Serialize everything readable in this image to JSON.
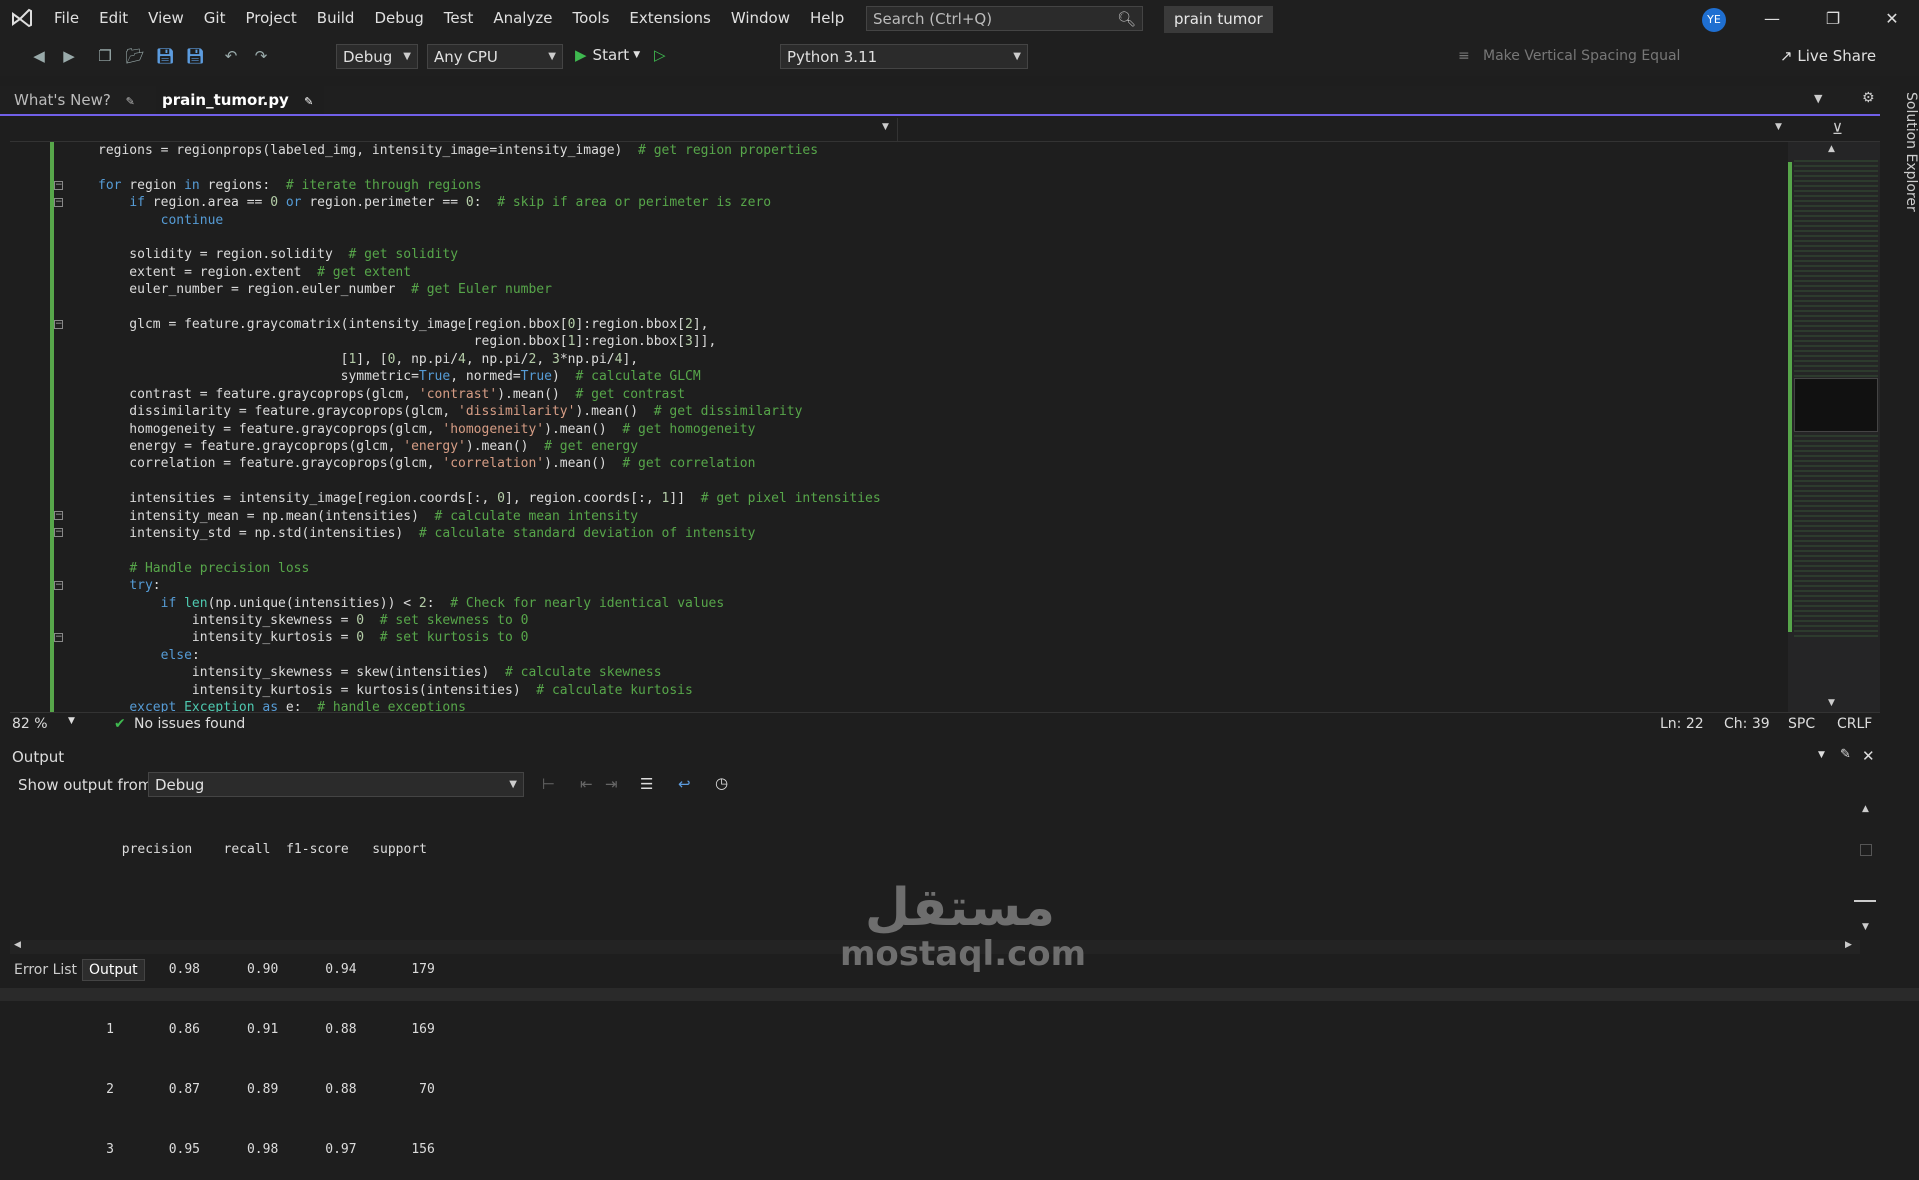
{
  "titlebar": {
    "menu": [
      "File",
      "Edit",
      "View",
      "Git",
      "Project",
      "Build",
      "Debug",
      "Test",
      "Analyze",
      "Tools",
      "Extensions",
      "Window",
      "Help"
    ],
    "search_placeholder": "Search (Ctrl+Q)",
    "solution_name": "prain tumor",
    "avatar_initials": "YE"
  },
  "toolbar": {
    "config": "Debug",
    "platform": "Any CPU",
    "start_label": "Start",
    "python_env": "Python 3.11",
    "spacing_label": "Make Vertical Spacing Equal",
    "live_share": "Live Share"
  },
  "tabs": {
    "whats_new": "What's New?",
    "active_file": "prain_tumor.py"
  },
  "side_panel": "Solution Explorer",
  "editor_status": {
    "zoom": "82 %",
    "issues": "No issues found",
    "line": "Ln: 22",
    "col": "Ch: 39",
    "spacing": "SPC",
    "eol": "CRLF"
  },
  "output": {
    "title": "Output",
    "show_from_label": "Show output from:",
    "source": "Debug",
    "header": "             precision    recall  f1-score   support",
    "rows": [
      "           0       0.98      0.90      0.94       179",
      "           1       0.86      0.91      0.88       169",
      "           2       0.87      0.89      0.88        70",
      "           3       0.95      0.98      0.97       156"
    ]
  },
  "bottom_tabs": [
    "Error List",
    "Output"
  ],
  "watermark": {
    "arabic": "مستقل",
    "latin": "mostaql.com"
  },
  "code_lines": [
    "regions = regionprops(labeled_img, intensity_image=intensity_image)  # get region properties",
    "",
    "for region in regions:  # iterate through regions",
    "    if region.area == 0 or region.perimeter == 0:  # skip if area or perimeter is zero",
    "        continue",
    "",
    "    solidity = region.solidity  # get solidity",
    "    extent = region.extent  # get extent",
    "    euler_number = region.euler_number  # get Euler number",
    "",
    "    glcm = feature.graycomatrix(intensity_image[region.bbox[0]:region.bbox[2],",
    "                                                region.bbox[1]:region.bbox[3]],",
    "                               [1], [0, np.pi/4, np.pi/2, 3*np.pi/4],",
    "                               symmetric=True, normed=True)  # calculate GLCM",
    "    contrast = feature.graycoprops(glcm, 'contrast').mean()  # get contrast",
    "    dissimilarity = feature.graycoprops(glcm, 'dissimilarity').mean()  # get dissimilarity",
    "    homogeneity = feature.graycoprops(glcm, 'homogeneity').mean()  # get homogeneity",
    "    energy = feature.graycoprops(glcm, 'energy').mean()  # get energy",
    "    correlation = feature.graycoprops(glcm, 'correlation').mean()  # get correlation",
    "",
    "    intensities = intensity_image[region.coords[:, 0], region.coords[:, 1]]  # get pixel intensities",
    "    intensity_mean = np.mean(intensities)  # calculate mean intensity",
    "    intensity_std = np.std(intensities)  # calculate standard deviation of intensity",
    "",
    "    # Handle precision loss",
    "    try:",
    "        if len(np.unique(intensities)) < 2:  # Check for nearly identical values",
    "            intensity_skewness = 0  # set skewness to 0",
    "            intensity_kurtosis = 0  # set kurtosis to 0",
    "        else:",
    "            intensity_skewness = skew(intensities)  # calculate skewness",
    "            intensity_kurtosis = kurtosis(intensities)  # calculate kurtosis",
    "    except Exception as e:  # handle exceptions"
  ]
}
